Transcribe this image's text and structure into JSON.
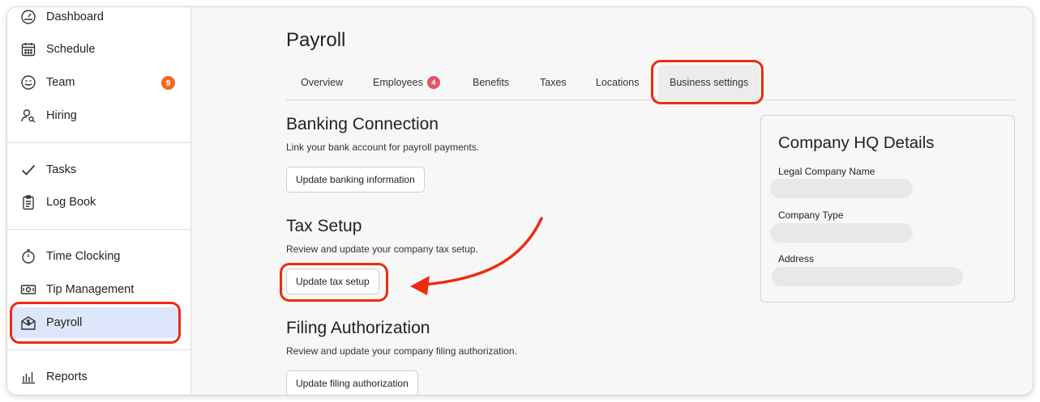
{
  "sidebar": {
    "items": [
      {
        "label": "Dashboard",
        "icon": "dashboard-gauge-icon"
      },
      {
        "label": "Schedule",
        "icon": "calendar-icon"
      },
      {
        "label": "Team",
        "icon": "smiley-face-icon",
        "badge": "9"
      },
      {
        "label": "Hiring",
        "icon": "person-search-icon"
      },
      {
        "label": "Tasks",
        "icon": "checkmark-icon"
      },
      {
        "label": "Log Book",
        "icon": "clipboard-icon"
      },
      {
        "label": "Time Clocking",
        "icon": "stopwatch-icon"
      },
      {
        "label": "Tip Management",
        "icon": "cash-icon"
      },
      {
        "label": "Payroll",
        "icon": "payroll-envelope-icon",
        "active": true
      },
      {
        "label": "Reports",
        "icon": "bar-chart-icon"
      }
    ]
  },
  "main": {
    "title": "Payroll",
    "tabs": [
      {
        "label": "Overview"
      },
      {
        "label": "Employees",
        "badge": "4"
      },
      {
        "label": "Benefits"
      },
      {
        "label": "Taxes"
      },
      {
        "label": "Locations"
      },
      {
        "label": "Business settings",
        "active": true
      }
    ],
    "sections": [
      {
        "title": "Banking Connection",
        "description": "Link your bank account for payroll payments.",
        "button": "Update banking information"
      },
      {
        "title": "Tax Setup",
        "description": "Review and update your company tax setup.",
        "button": "Update tax setup"
      },
      {
        "title": "Filing Authorization",
        "description": "Review and update your company filing authorization.",
        "button": "Update filing authorization"
      }
    ]
  },
  "hq_card": {
    "title": "Company HQ Details",
    "fields": [
      {
        "label": "Legal Company Name",
        "value": ""
      },
      {
        "label": "Company Type",
        "value": ""
      },
      {
        "label": "Address",
        "value": ""
      }
    ]
  },
  "colors": {
    "annotation": "#ec2b10",
    "active_nav": "#dde6fb",
    "team_badge": "#f06a1f",
    "tab_badge": "#e0536a"
  }
}
